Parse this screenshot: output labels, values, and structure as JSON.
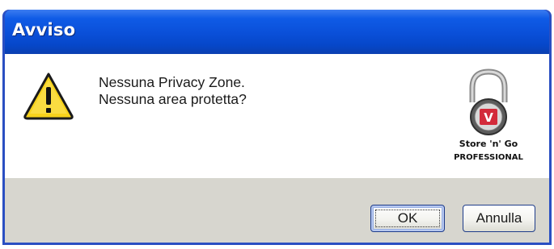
{
  "window": {
    "title": "Avviso"
  },
  "message": {
    "line1": "Nessuna Privacy Zone.",
    "line2": "Nessuna area protetta?"
  },
  "icon": {
    "name": "warning-icon"
  },
  "brand": {
    "line1": "Store 'n' Go",
    "line2": "PROFESSIONAL",
    "badge_letter": "V",
    "badge_color": "#d32a3a"
  },
  "buttons": {
    "ok_label": "OK",
    "cancel_label": "Annulla"
  },
  "colors": {
    "titlebar": "#0a4fd8",
    "frame": "#2a4fc2",
    "footer": "#d7d6cf",
    "warning_fill": "#f7d21c"
  }
}
